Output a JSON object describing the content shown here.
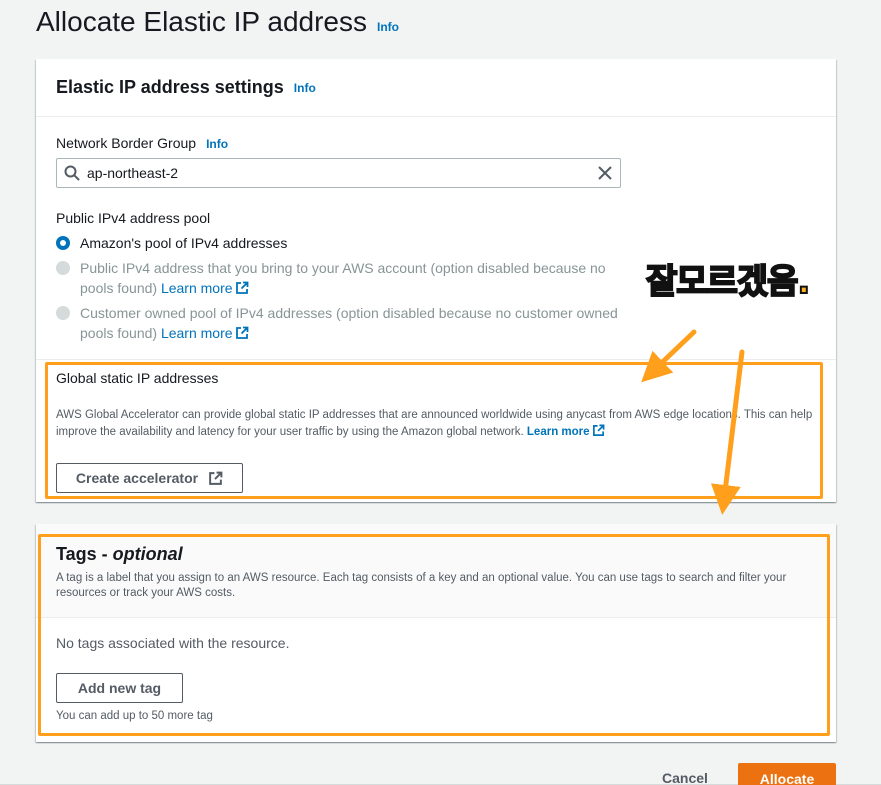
{
  "page": {
    "title": "Allocate Elastic IP address",
    "info": "Info"
  },
  "settings": {
    "header": "Elastic IP address settings",
    "info": "Info",
    "nbg_label": "Network Border Group",
    "nbg_info": "Info",
    "nbg_value": "ap-northeast-2",
    "pool_label": "Public IPv4 address pool",
    "options": [
      {
        "label": "Amazon's pool of IPv4 addresses",
        "checked": true,
        "disabled": false
      },
      {
        "label": "Public IPv4 address that you bring to your AWS account (option disabled because no pools found)",
        "learn_more": "Learn more",
        "checked": false,
        "disabled": true
      },
      {
        "label": "Customer owned pool of IPv4 addresses (option disabled because no customer owned pools found)",
        "learn_more": "Learn more",
        "checked": false,
        "disabled": true
      }
    ],
    "gsa_title": "Global static IP addresses",
    "gsa_desc": "AWS Global Accelerator can provide global static IP addresses that are announced worldwide using anycast from AWS edge locations. This can help improve the availability and latency for your user traffic by using the Amazon global network.",
    "gsa_learn_more": "Learn more",
    "create_accelerator": "Create accelerator"
  },
  "tags": {
    "title": "Tags - ",
    "title_optional": "optional",
    "desc": "A tag is a label that you assign to an AWS resource. Each tag consists of a key and an optional value. You can use tags to search and filter your resources or track your AWS costs.",
    "empty": "No tags associated with the resource.",
    "add_button": "Add new tag",
    "limit": "You can add up to 50 more tag"
  },
  "footer": {
    "cancel": "Cancel",
    "allocate": "Allocate"
  },
  "annotation": {
    "text": "잘모르겠음.",
    "color": "#ffb01f"
  },
  "colors": {
    "accent": "#0073bb",
    "primary_button": "#ec7211",
    "highlight": "#ff9f1c"
  }
}
